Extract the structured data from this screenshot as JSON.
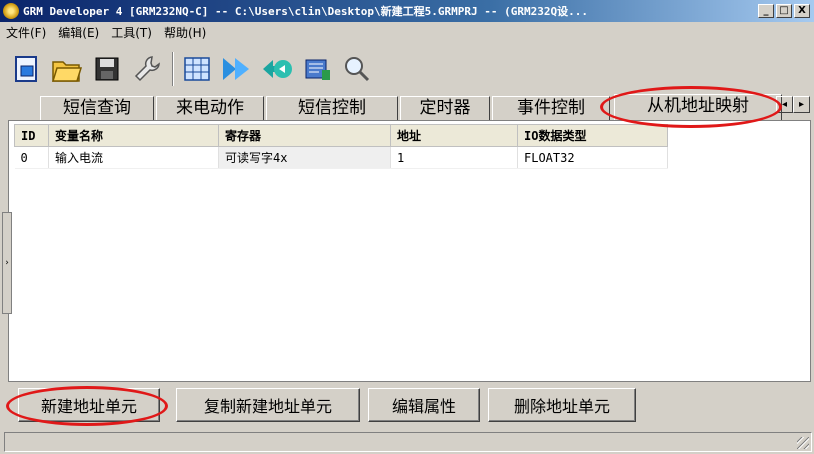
{
  "window": {
    "title": "GRM Developer 4 [GRM232NQ-C]  -- C:\\Users\\clin\\Desktop\\新建工程5.GRMPRJ --  (GRM232Q设...",
    "controls": [
      "_",
      "□",
      "X"
    ]
  },
  "menu": [
    "文件(F)",
    "编辑(E)",
    "工具(T)",
    "帮助(H)"
  ],
  "toolbar": {
    "icons": [
      "new-project-icon",
      "open-folder-icon",
      "save-icon",
      "settings-wrench-icon",
      "grid-icon",
      "download-icon",
      "upload-icon",
      "monitor-icon",
      "search-icon"
    ]
  },
  "tabs": {
    "items": [
      "短信查询",
      "来电动作",
      "短信控制",
      "定时器",
      "事件控制",
      "从机地址映射"
    ],
    "active_index": 5,
    "scroll_left": "◂",
    "scroll_right": "▸"
  },
  "table": {
    "columns": [
      "ID",
      "变量名称",
      "寄存器",
      "地址",
      "IO数据类型"
    ],
    "rows": [
      [
        "0",
        "输入电流",
        "可读写字4x",
        "1",
        "FLOAT32"
      ]
    ]
  },
  "splitter_glyph": "›",
  "buttons": {
    "new_address": "新建地址单元",
    "copy_new_address": "复制新建地址单元",
    "edit_properties": "编辑属性",
    "delete_address": "删除地址单元"
  },
  "colors": {
    "annotation": "#e01818",
    "titlebar_start": "#0a246a",
    "titlebar_end": "#a6caf0"
  }
}
